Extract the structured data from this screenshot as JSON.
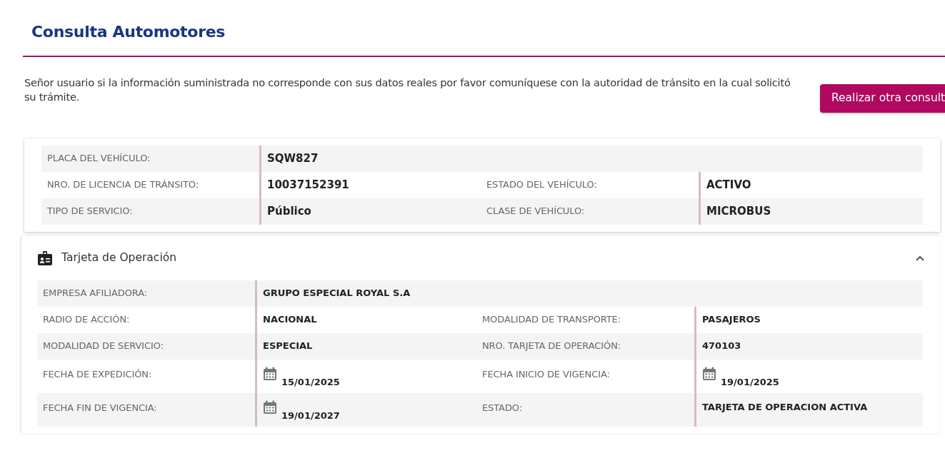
{
  "title": "Consulta Automotores",
  "notice": "Señor usuario si la información suministrada no corresponde con sus datos reales por favor comuníquese con la autoridad de tránsito en la cual solicitó su trámite.",
  "action_button": "Realizar otra consult",
  "vehicle": {
    "rows": [
      [
        {
          "label": "PLACA DEL VEHÍCULO:",
          "value": "SQW827",
          "kind": "text"
        }
      ],
      [
        {
          "label": "NRO. DE LICENCIA DE TRÁNSITO:",
          "value": "10037152391",
          "kind": "text"
        },
        {
          "label": "ESTADO DEL VEHÍCULO:",
          "value": "ACTIVO",
          "kind": "text"
        }
      ],
      [
        {
          "label": "TIPO DE SERVICIO:",
          "value": "Público",
          "kind": "text"
        },
        {
          "label": "CLASE DE VEHÍCULO:",
          "value": "MICROBUS",
          "kind": "text"
        }
      ]
    ]
  },
  "operation_card": {
    "title": "Tarjeta de Operación",
    "expanded": true,
    "rows": [
      [
        {
          "label": "EMPRESA AFILIADORA:",
          "value": "GRUPO ESPECIAL ROYAL S.A",
          "kind": "text"
        }
      ],
      [
        {
          "label": "RADIO DE ACCIÓN:",
          "value": "NACIONAL",
          "kind": "text"
        },
        {
          "label": "MODALIDAD DE TRANSPORTE:",
          "value": "PASAJEROS",
          "kind": "text"
        }
      ],
      [
        {
          "label": "MODALIDAD DE SERVICIO:",
          "value": "ESPECIAL",
          "kind": "text"
        },
        {
          "label": "NRO. TARJETA DE OPERACIÓN:",
          "value": "470103",
          "kind": "text"
        }
      ],
      [
        {
          "label": "FECHA DE EXPEDICIÓN:",
          "value": "15/01/2025",
          "kind": "date"
        },
        {
          "label": "FECHA INICIO DE VIGENCIA:",
          "value": "19/01/2025",
          "kind": "date"
        }
      ],
      [
        {
          "label": "FECHA FIN DE VIGENCIA:",
          "value": "19/01/2027",
          "kind": "date"
        },
        {
          "label": "ESTADO:",
          "value": "TARJETA DE OPERACION ACTIVA",
          "kind": "text"
        }
      ]
    ]
  }
}
